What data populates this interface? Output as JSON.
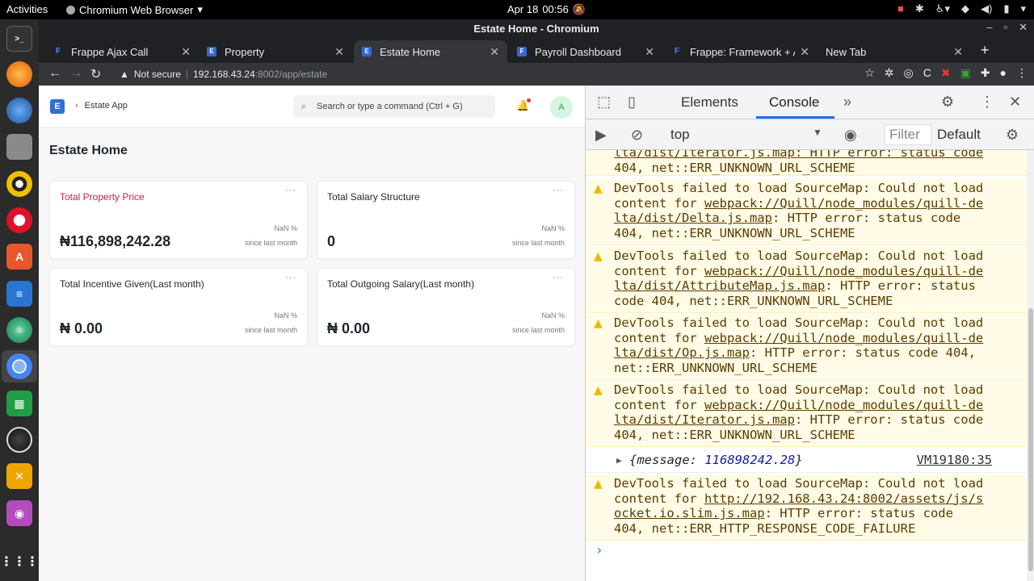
{
  "topbar": {
    "activities": "Activities",
    "app_name": "Chromium Web Browser",
    "date": "Apr 18",
    "time": "00:56"
  },
  "browser": {
    "window_title": "Estate Home - Chromium",
    "tabs": [
      {
        "label": "Frappe Ajax Call",
        "fav": "F"
      },
      {
        "label": "Property",
        "fav": "E"
      },
      {
        "label": "Estate Home",
        "fav": "E"
      },
      {
        "label": "Payroll Dashboard",
        "fav": "F"
      },
      {
        "label": "Frappe: Framework + A",
        "fav": "F"
      },
      {
        "label": "New Tab",
        "fav": ""
      }
    ],
    "security": "Not secure",
    "url_host": "192.168.43.24",
    "url_rest": ":8002/app/estate"
  },
  "page": {
    "logo": "E",
    "breadcrumb": "Estate App",
    "search_placeholder": "Search or type a command (Ctrl + G)",
    "avatar": "A",
    "title": "Estate Home",
    "cards": [
      {
        "title": "Total Property Price",
        "value": "₦116,898,242.28",
        "pct": "NaN %",
        "since": "since last month"
      },
      {
        "title": "Total Salary Structure",
        "value": "0",
        "pct": "NaN %",
        "since": "since last month"
      },
      {
        "title": "Total Incentive Given(Last month)",
        "value": "₦ 0.00",
        "pct": "NaN %",
        "since": "since last month"
      },
      {
        "title": "Total Outgoing Salary(Last month)",
        "value": "₦ 0.00",
        "pct": "NaN %",
        "since": "since last month"
      }
    ],
    "card_menu": "···"
  },
  "devtools": {
    "tab_elements": "Elements",
    "tab_console": "Console",
    "context": "top",
    "filter_placeholder": "Filter",
    "levels": "Default",
    "partial_top": {
      "l1": "lta/dist/Iterator.js.map: HTTP error: status code",
      "l2": "404, net::ERR_UNKNOWN_URL_SCHEME"
    },
    "warnings": [
      {
        "lines": [
          "DevTools failed to load SourceMap: Could not load",
          "content for ",
          "webpack://Quill/node_modules/quill-de",
          "lta/dist/Delta.js.map",
          ": HTTP error: status code",
          "404, net::ERR_UNKNOWN_URL_SCHEME"
        ]
      },
      {
        "lines": [
          "DevTools failed to load SourceMap: Could not load",
          "content for ",
          "webpack://Quill/node_modules/quill-de",
          "lta/dist/AttributeMap.js.map",
          ": HTTP error: status",
          "code 404, net::ERR_UNKNOWN_URL_SCHEME"
        ]
      },
      {
        "lines": [
          "DevTools failed to load SourceMap: Could not load",
          "content for ",
          "webpack://Quill/node_modules/quill-de",
          "lta/dist/Op.js.map",
          ": HTTP error: status code 404,",
          "net::ERR_UNKNOWN_URL_SCHEME"
        ]
      },
      {
        "lines": [
          "DevTools failed to load SourceMap: Could not load",
          "content for ",
          "webpack://Quill/node_modules/quill-de",
          "lta/dist/Iterator.js.map",
          ": HTTP error: status code",
          "404, net::ERR_UNKNOWN_URL_SCHEME"
        ]
      }
    ],
    "log": {
      "prefix": "{message: ",
      "value": "116898242.28",
      "suffix": "}",
      "source": "VM19180:35"
    },
    "last_warning": {
      "l1": "DevTools failed to load SourceMap: Could not load",
      "l2a": "content for ",
      "l2b": "http://192.168.43.24:8002/assets/js/s",
      "l3a": "ocket.io.slim.js.map",
      "l3b": ": HTTP error: status code",
      "l4": "404, net::ERR_HTTP_RESPONSE_CODE_FAILURE"
    }
  }
}
